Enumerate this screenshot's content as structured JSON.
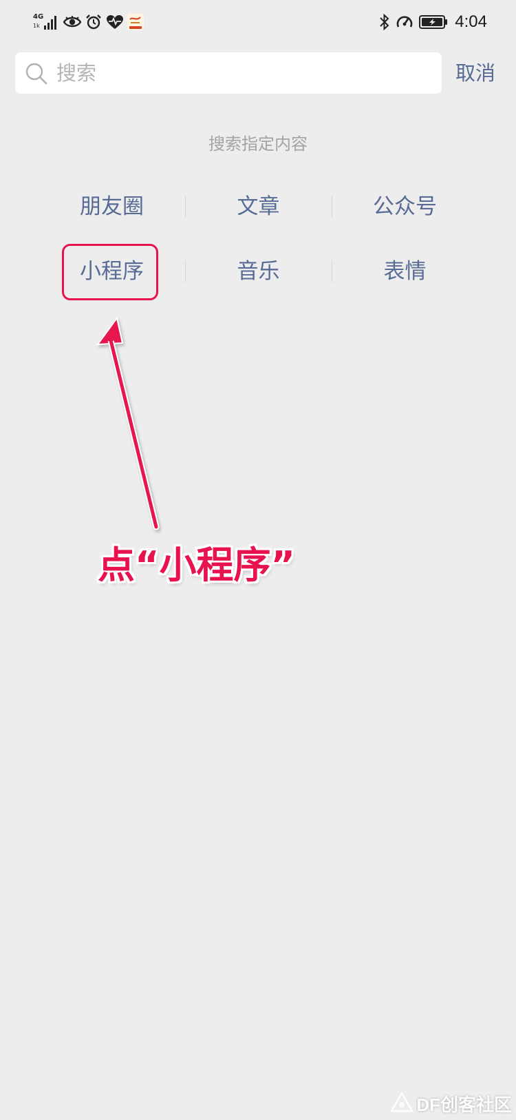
{
  "status_bar": {
    "network_gen": "4G",
    "network_speed": "1k",
    "time": "4:04",
    "left_icons": [
      "signal-bars-icon",
      "eye-icon",
      "alarm-clock-icon",
      "heart-rate-icon",
      "app-notification-icon"
    ],
    "right_icons": [
      "bluetooth-icon",
      "speedometer-icon",
      "battery-charging-icon"
    ]
  },
  "search": {
    "placeholder": "搜索",
    "value": "",
    "cancel_label": "取消"
  },
  "categories": {
    "title": "搜索指定内容",
    "items": [
      {
        "label": "朋友圈"
      },
      {
        "label": "文章"
      },
      {
        "label": "公众号"
      },
      {
        "label": "小程序"
      },
      {
        "label": "音乐"
      },
      {
        "label": "表情"
      }
    ]
  },
  "annotation": {
    "text": "点“小程序”",
    "highlighted_item": "小程序",
    "color": "#e8124f"
  },
  "watermark": {
    "text": "DF创客社区"
  },
  "colors": {
    "background": "#ededed",
    "link": "#576b95",
    "hint": "#a3a3a3",
    "annotation": "#e8124f"
  }
}
